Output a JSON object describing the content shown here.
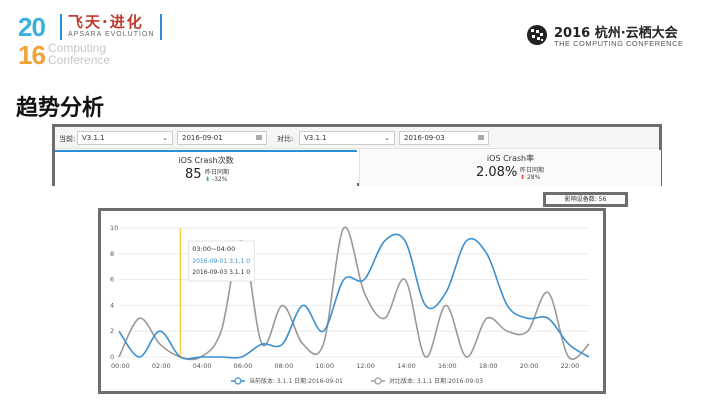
{
  "header": {
    "logo_year_top": "20",
    "logo_year_bottom": "16",
    "logo_computing": "Computing\nConference",
    "logo_cn": "飞天·进化",
    "logo_en": "APSARA EVOLUTION",
    "right_title": "2016 杭州·云栖大会",
    "right_subtitle": "THE COMPUTING CONFERENCE"
  },
  "slide_title": "趋势分析",
  "filters": {
    "current_label": "当前:",
    "current_version": "V3.1.1",
    "current_date": "2016-09-01",
    "compare_label": "对比:",
    "compare_version": "V3.1.1",
    "compare_date": "2016-09-03"
  },
  "metrics": [
    {
      "title": "iOS Crash次数",
      "value": "85",
      "sub_label": "昨日同期",
      "change": "-32%",
      "direction": "down"
    },
    {
      "title": "iOS Crash率",
      "value": "2.08%",
      "sub_label": "昨日同期",
      "change": "28%",
      "direction": "up"
    }
  ],
  "device_count": "影响设备数: 56",
  "colors": {
    "accent": "#2a8fd6",
    "current_series": "#3a8fd0",
    "compare_series": "#999999",
    "down": "#27ae60",
    "up": "#e74c3c",
    "cursor": "#f5c000"
  },
  "chart_data": {
    "type": "line",
    "x_ticks": [
      "00:00",
      "02:00",
      "04:00",
      "06:00",
      "08:00",
      "10:00",
      "12:00",
      "14:00",
      "16:00",
      "18:00",
      "20:00",
      "22:00"
    ],
    "xlim": [
      0,
      23
    ],
    "ylim": [
      0,
      10
    ],
    "y_ticks": [
      "0",
      "2",
      "4",
      "6",
      "8",
      "10"
    ],
    "grid": true,
    "legend_position": "bottom",
    "series": [
      {
        "name": "当前版本: 3.1.1 日期:2016-09-01",
        "x": [
          0,
          1,
          2,
          3,
          4,
          5,
          6,
          7,
          8,
          9,
          10,
          11,
          12,
          13,
          14,
          15,
          16,
          17,
          18,
          19,
          20,
          21,
          22,
          23
        ],
        "values": [
          2,
          0,
          2,
          0,
          0,
          0,
          0,
          1,
          1,
          4,
          2,
          6,
          6,
          9,
          9,
          4,
          5,
          9,
          8,
          4,
          3,
          3,
          1,
          0
        ]
      },
      {
        "name": "对比版本: 3.1.1 日期:2016-09-03",
        "x": [
          0,
          1,
          2,
          3,
          4,
          5,
          6,
          7,
          8,
          9,
          10,
          11,
          12,
          13,
          14,
          15,
          16,
          17,
          18,
          19,
          20,
          21,
          22,
          23
        ],
        "values": [
          0,
          3,
          1,
          0,
          0,
          2,
          9,
          1,
          4,
          1,
          1,
          10,
          5,
          3,
          6,
          0,
          4,
          0,
          3,
          2,
          2,
          5,
          0,
          1
        ]
      }
    ],
    "cursor_x": 3,
    "tooltip": {
      "title": "03:00~04:00",
      "rows": [
        "2016-09-01  3.1.1  0",
        "2016-09-03  3.1.1  0"
      ]
    }
  }
}
